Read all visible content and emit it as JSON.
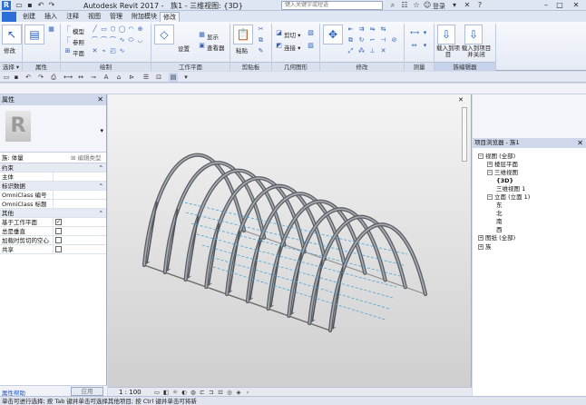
{
  "titlebar": {
    "logo": "R",
    "window_title": "Autodesk Revit 2017 -",
    "file_title": "族1 - 三维视图: {3D}",
    "search_placeholder": "键入关键字或短语",
    "user": "登录",
    "help": "?"
  },
  "ribbon_tabs": [
    "创建",
    "插入",
    "注释",
    "视图",
    "管理",
    "附加模块",
    "修改"
  ],
  "ribbon_active_tab": "修改",
  "ribbon": {
    "modify_label": "修改",
    "panels": [
      "选择 ▾",
      "属性",
      "绘制",
      "工作平面",
      "剪贴板",
      "几何图形",
      "修改",
      "测量",
      "族编辑器"
    ],
    "draw_buttons": [
      "模型",
      "参照",
      "平面"
    ],
    "workplane_buttons": [
      "设置",
      "显示",
      "查看器"
    ],
    "clipboard_buttons": [
      "粘贴"
    ],
    "geometry_buttons": [
      "剪切 ▾",
      "连接 ▾"
    ],
    "family_editor_buttons": [
      "载入到项目",
      "载入到项目并关闭"
    ]
  },
  "properties": {
    "header": "属性",
    "type_selector": "族: 体量",
    "edit_type": "编辑类型",
    "rows": [
      {
        "label": "约束",
        "group": true,
        "value": ""
      },
      {
        "label": "主体",
        "group": false,
        "value": ""
      },
      {
        "label": "标识数据",
        "group": true,
        "value": ""
      },
      {
        "label": "OmniClass 编号",
        "group": false,
        "value": ""
      },
      {
        "label": "OmniClass 标题",
        "group": false,
        "value": ""
      },
      {
        "label": "其他",
        "group": true,
        "value": ""
      },
      {
        "label": "基于工作平面",
        "group": false,
        "check": true
      },
      {
        "label": "总是垂直",
        "group": false,
        "check": false
      },
      {
        "label": "加载时剪切的空心",
        "group": false,
        "check": false
      },
      {
        "label": "共享",
        "group": false,
        "check": false
      }
    ],
    "help_link": "属性帮助",
    "apply": "应用"
  },
  "viewport": {
    "scale": "1 : 100",
    "ribs": 10
  },
  "project_browser": {
    "header": "项目浏览器 - 族1",
    "items": [
      {
        "label": "视图 (全部)",
        "level": 0,
        "exp": "−"
      },
      {
        "label": "楼层平面",
        "level": 1,
        "exp": "+"
      },
      {
        "label": "三维视图",
        "level": 1,
        "exp": "−"
      },
      {
        "label": "{3D}",
        "level": 2,
        "bold": true
      },
      {
        "label": "三维视图 1",
        "level": 2
      },
      {
        "label": "立面 (立面 1)",
        "level": 1,
        "exp": "−"
      },
      {
        "label": "东",
        "level": 2
      },
      {
        "label": "北",
        "level": 2
      },
      {
        "label": "南",
        "level": 2
      },
      {
        "label": "西",
        "level": 2
      },
      {
        "label": "图纸 (全部)",
        "level": 0,
        "exp": "+"
      },
      {
        "label": "族",
        "level": 0,
        "exp": "+"
      }
    ]
  },
  "status_bar": "单击可进行选择; 按 Tab 键并单击可选择其他项目; 按 Ctrl 键并单击可将新",
  "colors": {
    "accent": "#2b6fd6",
    "ribbon": "#e5eaf4",
    "viewport_top": "#f4f4f4"
  }
}
